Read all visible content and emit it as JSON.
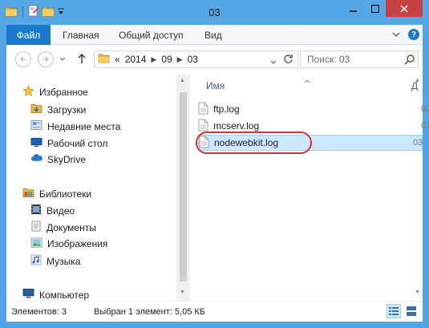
{
  "window": {
    "title": "03"
  },
  "colors": {
    "titlebar": "#55a8e8",
    "file_tab": "#1979ca",
    "close_button": "#c7413f",
    "selection": "#cce8ff",
    "annotation_ring": "#e0302e"
  },
  "ribbon": {
    "file_tab": "Файл",
    "tabs": [
      "Главная",
      "Общий доступ",
      "Вид"
    ],
    "help_label": "?"
  },
  "address": {
    "segments": [
      "«",
      "2014",
      "09",
      "03"
    ]
  },
  "search": {
    "placeholder": "Поиск: 03"
  },
  "nav_pane": {
    "favorites_label": "Избранное",
    "favorites": [
      "Загрузки",
      "Недавние места",
      "Рабочий стол",
      "SkyDrive"
    ],
    "libraries_label": "Библиотеки",
    "libraries": [
      "Видео",
      "Документы",
      "Изображения",
      "Музыка"
    ],
    "computer_label": "Компьютер"
  },
  "file_list": {
    "column_name": "Имя",
    "column_date_cut": "Д",
    "files": [
      {
        "name": "ftp.log",
        "date_cut": "03"
      },
      {
        "name": "mcserv.log",
        "date_cut": "03"
      },
      {
        "name": "nodewebkit.log",
        "date_cut": "03"
      }
    ]
  },
  "status": {
    "item_count": "Элементов: 3",
    "selection": "Выбран 1 элемент: 5,05 КБ"
  },
  "icons": {
    "titlebar": [
      "folder-icon",
      "properties-icon",
      "new-folder-icon",
      "qat-dropdown-icon"
    ],
    "nav": [
      "back-arrow-icon",
      "forward-arrow-icon",
      "recent-dropdown-icon",
      "up-arrow-icon",
      "refresh-icon",
      "search-icon"
    ]
  }
}
